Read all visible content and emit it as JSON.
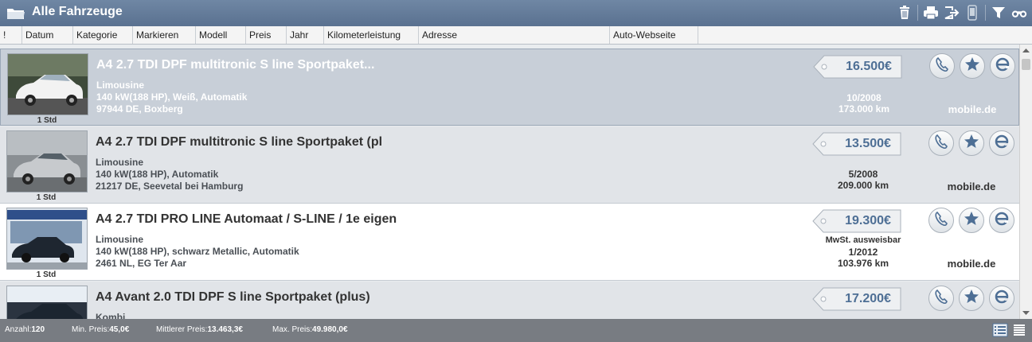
{
  "app": {
    "title": "Alle Fahrzeuge"
  },
  "toolbar": {
    "icons": [
      "trash-icon",
      "print-icon",
      "export-icon",
      "mobile-icon",
      "filter-icon",
      "binoculars-icon"
    ]
  },
  "columns": [
    "!",
    "Datum",
    "Kategorie",
    "Markieren",
    "Modell",
    "Preis",
    "Jahr",
    "Kilometerleistung",
    "Adresse",
    "Auto-Webseite"
  ],
  "listings": [
    {
      "title": "A4 2.7 TDI DPF multitronic S line Sportpaket...",
      "category": "Limousine",
      "specs": "140 kW(188 HP), Weiß, Automatik",
      "location": "97944 DE, Boxberg",
      "age": "1 Std",
      "price": "16.500€",
      "vat": "",
      "date": "10/2008",
      "km": "173.000 km",
      "source": "mobile.de"
    },
    {
      "title": "A4 2.7 TDI DPF multitronic S line Sportpaket (pl",
      "category": "Limousine",
      "specs": "140 kW(188 HP), Automatik",
      "location": "21217 DE, Seevetal bei Hamburg",
      "age": "1 Std",
      "price": "13.500€",
      "vat": "",
      "date": "5/2008",
      "km": "209.000 km",
      "source": "mobile.de"
    },
    {
      "title": "A4 2.7 TDI PRO LINE Automaat / S-LINE / 1e eigen",
      "category": "Limousine",
      "specs": "140 kW(188 HP), schwarz Metallic, Automatik",
      "location": "2461 NL, EG Ter Aar",
      "age": "1 Std",
      "price": "19.300€",
      "vat": "MwSt. ausweisbar",
      "date": "1/2012",
      "km": "103.976 km",
      "source": "mobile.de"
    },
    {
      "title": "A4 Avant 2.0 TDI DPF S line Sportpaket (plus)",
      "category": "Kombi",
      "specs": "",
      "location": "",
      "age": "",
      "price": "17.200€",
      "vat": "",
      "date": "",
      "km": "",
      "source": ""
    }
  ],
  "status": {
    "count_label": "Anzahl:",
    "count_value": "120",
    "min_label": "Min. Preis:",
    "min_value": "45,0€",
    "avg_label": "Mittlerer Preis:",
    "avg_value": "13.463,3€",
    "max_label": "Max. Preis:",
    "max_value": "49.980,0€"
  },
  "colors": {
    "titlebar": "#5a7190",
    "selected_row": "#c8cfd8",
    "price_text": "#4e6f95",
    "statusbar": "#787c82"
  }
}
